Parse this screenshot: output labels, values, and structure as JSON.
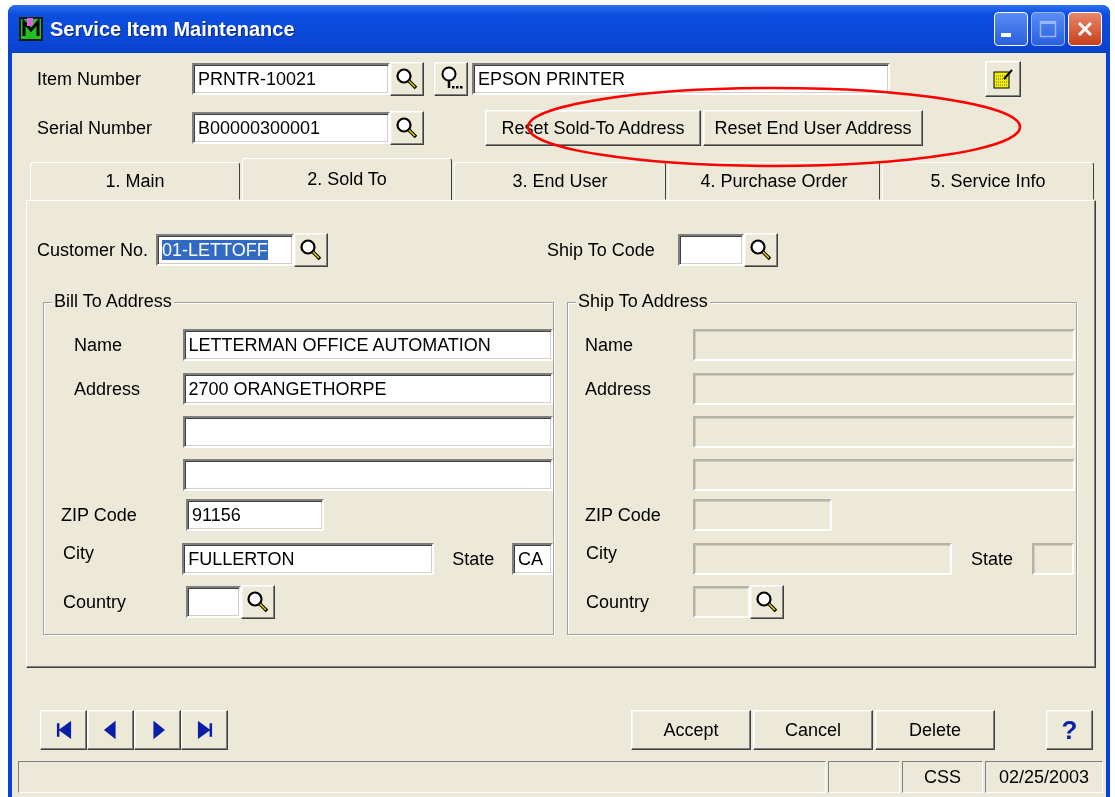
{
  "window": {
    "title": "Service Item Maintenance"
  },
  "header": {
    "item_number": {
      "label": "Item Number",
      "value": "PRNTR-10021"
    },
    "description": {
      "value": "EPSON PRINTER"
    },
    "serial_number": {
      "label": "Serial Number",
      "value": "B00000300001"
    },
    "buttons": [
      "Reset Sold-To Address",
      "Reset End User Address"
    ]
  },
  "annotation": {
    "kind": "ellipse"
  },
  "tabs": [
    {
      "label": "1. Main",
      "selected": false
    },
    {
      "label": "2. Sold To",
      "selected": true
    },
    {
      "label": "3. End User",
      "selected": false
    },
    {
      "label": "4. Purchase Order",
      "selected": false
    },
    {
      "label": "5. Service Info",
      "selected": false
    }
  ],
  "sold_to": {
    "customer_no": {
      "label": "Customer No.",
      "value": "01-LETTOFF",
      "highlighted": true
    },
    "ship_to_code": {
      "label": "Ship To Code"
    }
  },
  "bill_to": {
    "title": "Bill To Address",
    "disabled": false,
    "name": {
      "label": "Name",
      "value": "LETTERMAN OFFICE AUTOMATION"
    },
    "address": {
      "label": "Address",
      "lines": [
        "2700 ORANGETHORPE"
      ]
    },
    "zip": {
      "label": "ZIP Code",
      "value": "91156"
    },
    "city": {
      "label": "City",
      "value": "FULLERTON"
    },
    "state": {
      "label": "State",
      "value": "CA"
    },
    "country": {
      "label": "Country"
    }
  },
  "ship_to": {
    "title": "Ship To Address",
    "disabled": true,
    "name": {
      "label": "Name"
    },
    "address": {
      "label": "Address"
    },
    "zip": {
      "label": "ZIP Code"
    },
    "city": {
      "label": "City"
    },
    "state": {
      "label": "State"
    },
    "country": {
      "label": "Country"
    }
  },
  "footer_buttons": [
    "Accept",
    "Cancel",
    "Delete"
  ],
  "help_button": "?",
  "status_bar": {
    "panes": [
      "CSS",
      "02/25/2003"
    ]
  }
}
